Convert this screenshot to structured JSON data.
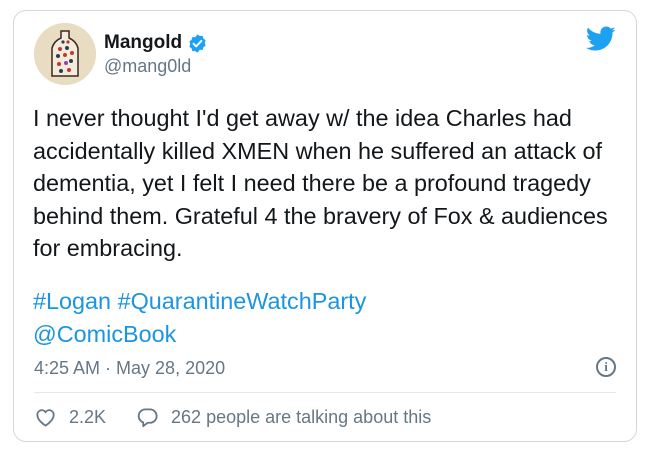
{
  "author": {
    "name": "Mangold",
    "handle": "@mang0ld",
    "verified": true,
    "avatar_icon": "bottle-portrait-avatar"
  },
  "tweet": {
    "text": "I never thought I'd get away w/ the idea Charles had\naccidentally killed XMEN when he suffered an attack of\ndementia, yet I felt I need there be a profound tragedy\nbehind them. Grateful 4 the bravery of Fox & audiences\nfor embracing.",
    "hashtag_1": "#Logan",
    "hashtag_2": "#QuarantineWatchParty",
    "mention": "@ComicBook",
    "timestamp": "4:25 AM · May 28, 2020"
  },
  "stats": {
    "likes": "2.2K",
    "talking": "262 people are talking about this"
  },
  "info_glyph": "i",
  "colors": {
    "link": "#1b95e0",
    "twitter_blue": "#1da1f2",
    "muted": "#657786",
    "border": "#d4d8dc"
  }
}
